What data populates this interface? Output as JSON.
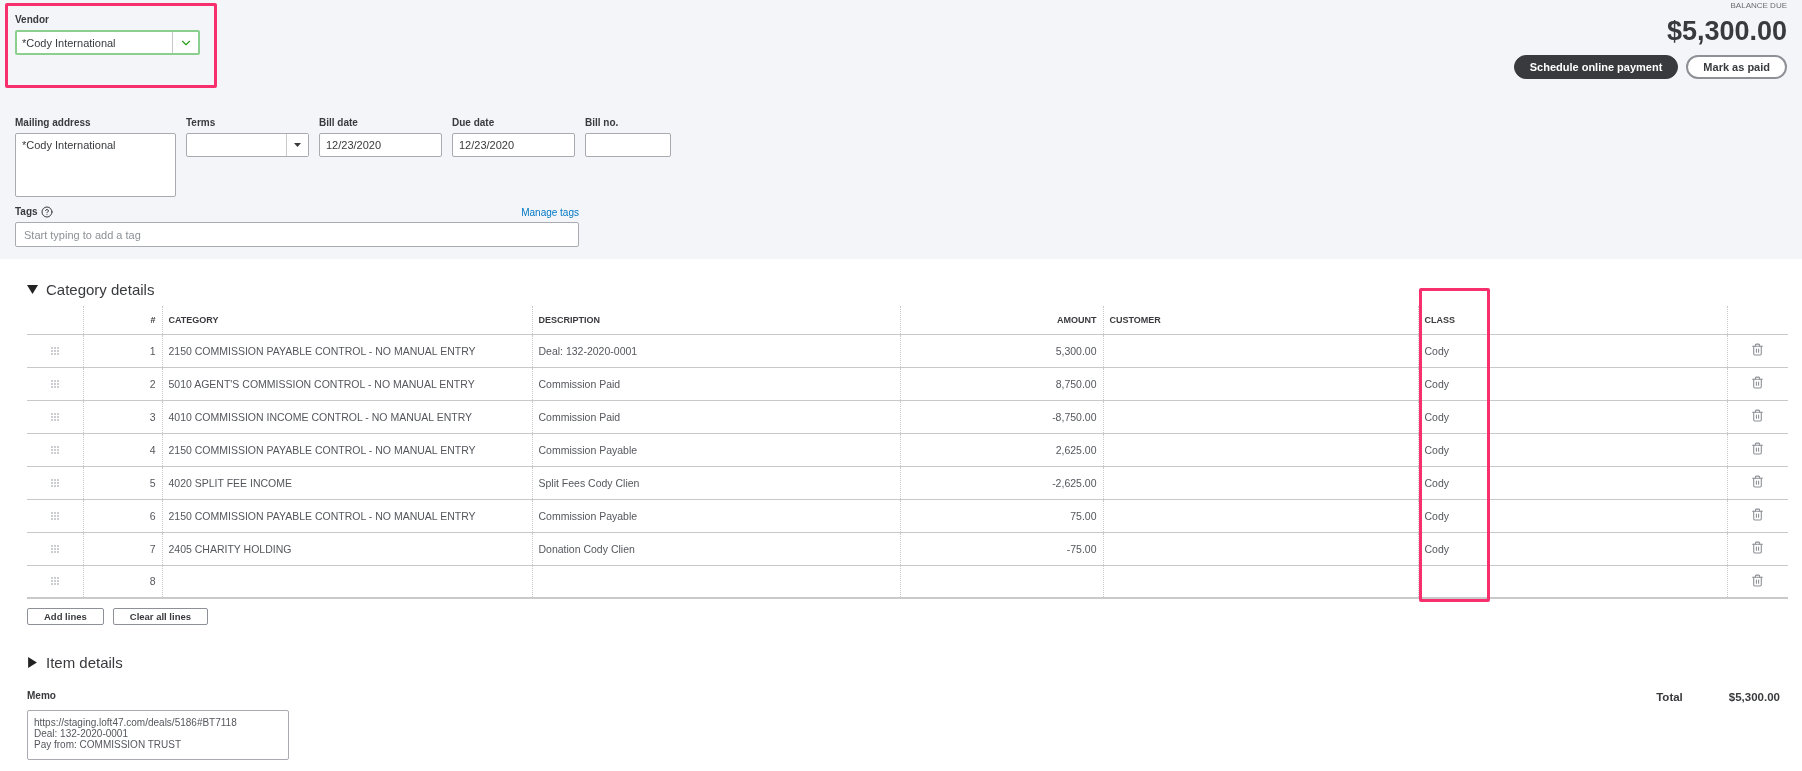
{
  "vendor": {
    "label": "Vendor",
    "value": "*Cody International"
  },
  "balance": {
    "label": "BALANCE DUE",
    "amount": "$5,300.00"
  },
  "actions": [
    {
      "label": "Schedule online payment",
      "kind": "primary"
    },
    {
      "label": "Mark as paid",
      "kind": "secondary"
    }
  ],
  "fields": [
    {
      "label": "Mailing address",
      "value": "*Cody International",
      "kind": "textarea"
    },
    {
      "label": "Terms",
      "kind": "select"
    },
    {
      "label": "Bill date",
      "value": "12/23/2020",
      "kind": "text"
    },
    {
      "label": "Due date",
      "value": "12/23/2020",
      "kind": "text"
    },
    {
      "label": "Bill no.",
      "kind": "short"
    }
  ],
  "tags": {
    "label": "Tags",
    "link": "Manage tags",
    "placeholder": "Start typing to add a tag"
  },
  "category_details": {
    "title": "Category details",
    "expanded": true,
    "columns": [
      "#",
      "CATEGORY",
      "DESCRIPTION",
      "AMOUNT",
      "CUSTOMER",
      "CLASS"
    ],
    "rows": [
      {
        "number": "1",
        "category": "2150 COMMISSION PAYABLE CONTROL - NO MANUAL ENTRY",
        "description": "Deal: 132-2020-0001",
        "amount": "5,300.00",
        "class": "Cody"
      },
      {
        "number": "2",
        "category": "5010 AGENT'S COMMISSION CONTROL - NO MANUAL ENTRY",
        "description": "Commission Paid",
        "amount": "8,750.00",
        "class": "Cody"
      },
      {
        "number": "3",
        "category": "4010 COMMISSION INCOME CONTROL - NO MANUAL ENTRY",
        "description": "Commission Paid",
        "amount": "-8,750.00",
        "class": "Cody"
      },
      {
        "number": "4",
        "category": "2150 COMMISSION PAYABLE CONTROL - NO MANUAL ENTRY",
        "description": "Commission Payable",
        "amount": "2,625.00",
        "class": "Cody"
      },
      {
        "number": "5",
        "category": "4020 SPLIT FEE INCOME",
        "description": "Split Fees Cody Clien",
        "amount": "-2,625.00",
        "class": "Cody"
      },
      {
        "number": "6",
        "category": "2150 COMMISSION PAYABLE CONTROL - NO MANUAL ENTRY",
        "description": "Commission Payable",
        "amount": "75.00",
        "class": "Cody"
      },
      {
        "number": "7",
        "category": "2405 CHARITY HOLDING",
        "description": "Donation Cody Clien",
        "amount": "-75.00",
        "class": "Cody"
      },
      {
        "number": "8"
      }
    ],
    "buttons": [
      "Add lines",
      "Clear all lines"
    ]
  },
  "item_details": {
    "title": "Item details",
    "expanded": false
  },
  "memo": {
    "label": "Memo",
    "value": "https://staging.loft47.com/deals/5186#BT7118\nDeal: 132-2020-0001\nPay from: COMMISSION TRUST"
  },
  "total": {
    "label": "Total",
    "amount": "$5,300.00"
  }
}
